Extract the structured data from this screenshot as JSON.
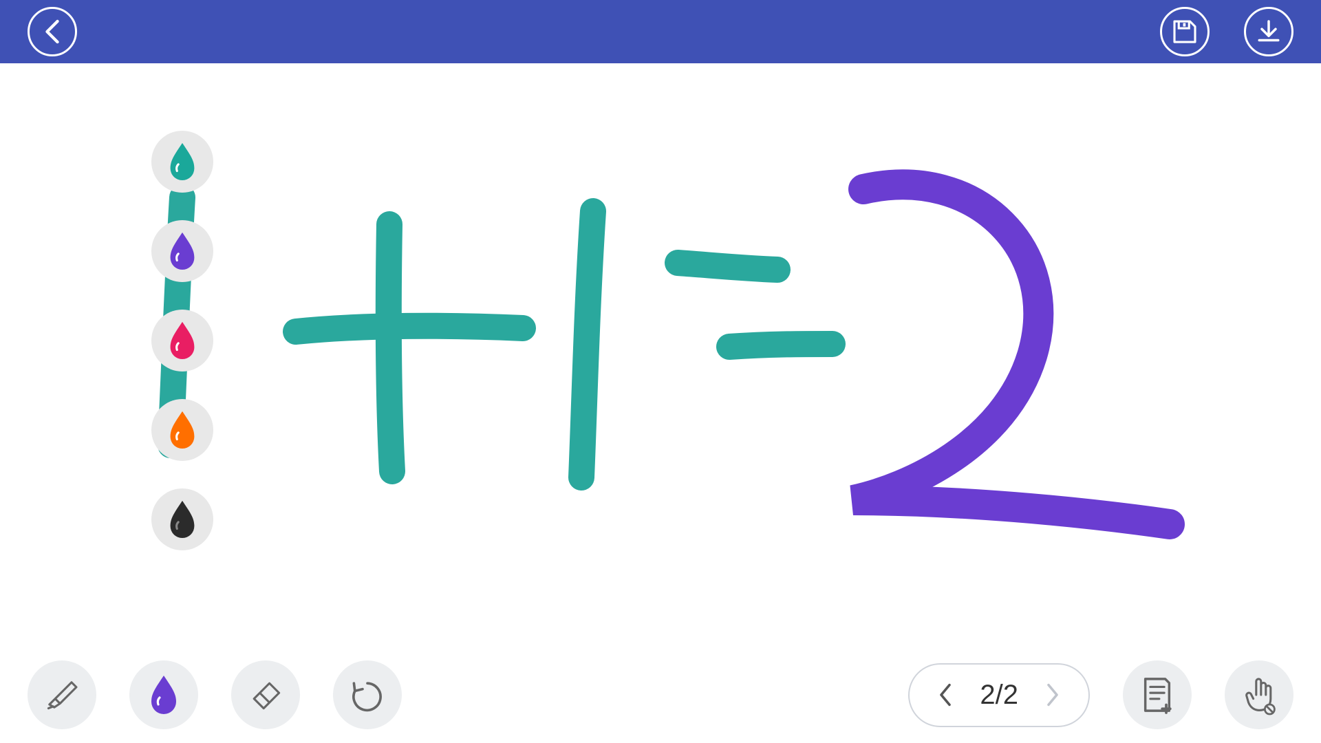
{
  "header": {
    "back_icon": "back",
    "save_icon": "save",
    "download_icon": "download"
  },
  "palette": {
    "colors": [
      {
        "name": "teal",
        "hex": "#1aa89a"
      },
      {
        "name": "purple",
        "hex": "#6a3dd1"
      },
      {
        "name": "pink",
        "hex": "#e91e63"
      },
      {
        "name": "orange",
        "hex": "#ff6f00"
      },
      {
        "name": "black",
        "hex": "#2b2b2b"
      }
    ]
  },
  "tools": {
    "highlighter_icon": "highlighter",
    "ink_icon": "ink",
    "eraser_icon": "eraser",
    "undo_icon": "undo",
    "add_page_icon": "add-page",
    "gesture_off_icon": "gesture-off",
    "current_ink_color": "#6a3dd1"
  },
  "pagination": {
    "label": "2/2",
    "current": 2,
    "total": 2,
    "prev_enabled": true,
    "next_enabled": false
  },
  "canvas": {
    "content_description": "Handwritten equation 1 + 1 = 2 where 1+1= is drawn in teal and 2 is drawn in purple"
  }
}
